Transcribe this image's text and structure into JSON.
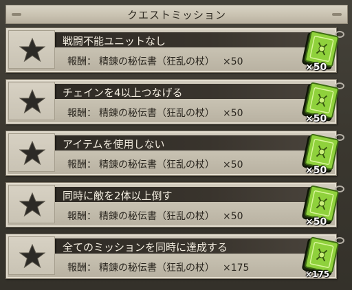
{
  "header": {
    "title": "クエストミッション"
  },
  "colors": {
    "card_bg": "#c9c3b4",
    "name_bar": "#34302a",
    "name_text": "#f2ecdf",
    "item_green": "#8fd13c",
    "star": "#2c2a26"
  },
  "missions": [
    {
      "name": "戦闘不能ユニットなし",
      "reward_label": "報酬：",
      "reward_item": "精錬の秘伝書（狂乱の杖）",
      "reward_qty": "×50",
      "item_count": "×50",
      "star_icon": "empty-star-icon",
      "item_icon": "secret-book-icon"
    },
    {
      "name": "チェインを4以上つなげる",
      "reward_label": "報酬：",
      "reward_item": "精錬の秘伝書（狂乱の杖）",
      "reward_qty": "×50",
      "item_count": "×50",
      "star_icon": "empty-star-icon",
      "item_icon": "secret-book-icon"
    },
    {
      "name": "アイテムを使用しない",
      "reward_label": "報酬：",
      "reward_item": "精錬の秘伝書（狂乱の杖）",
      "reward_qty": "×50",
      "item_count": "×50",
      "star_icon": "empty-star-icon",
      "item_icon": "secret-book-icon"
    },
    {
      "name": "同時に敵を2体以上倒す",
      "reward_label": "報酬：",
      "reward_item": "精錬の秘伝書（狂乱の杖）",
      "reward_qty": "×50",
      "item_count": "×50",
      "star_icon": "empty-star-icon",
      "item_icon": "secret-book-icon"
    },
    {
      "name": "全てのミッションを同時に達成する",
      "reward_label": "報酬：",
      "reward_item": "精錬の秘伝書（狂乱の杖）",
      "reward_qty": "×175",
      "item_count": "×175",
      "star_icon": "empty-star-icon",
      "item_icon": "secret-book-icon"
    }
  ]
}
